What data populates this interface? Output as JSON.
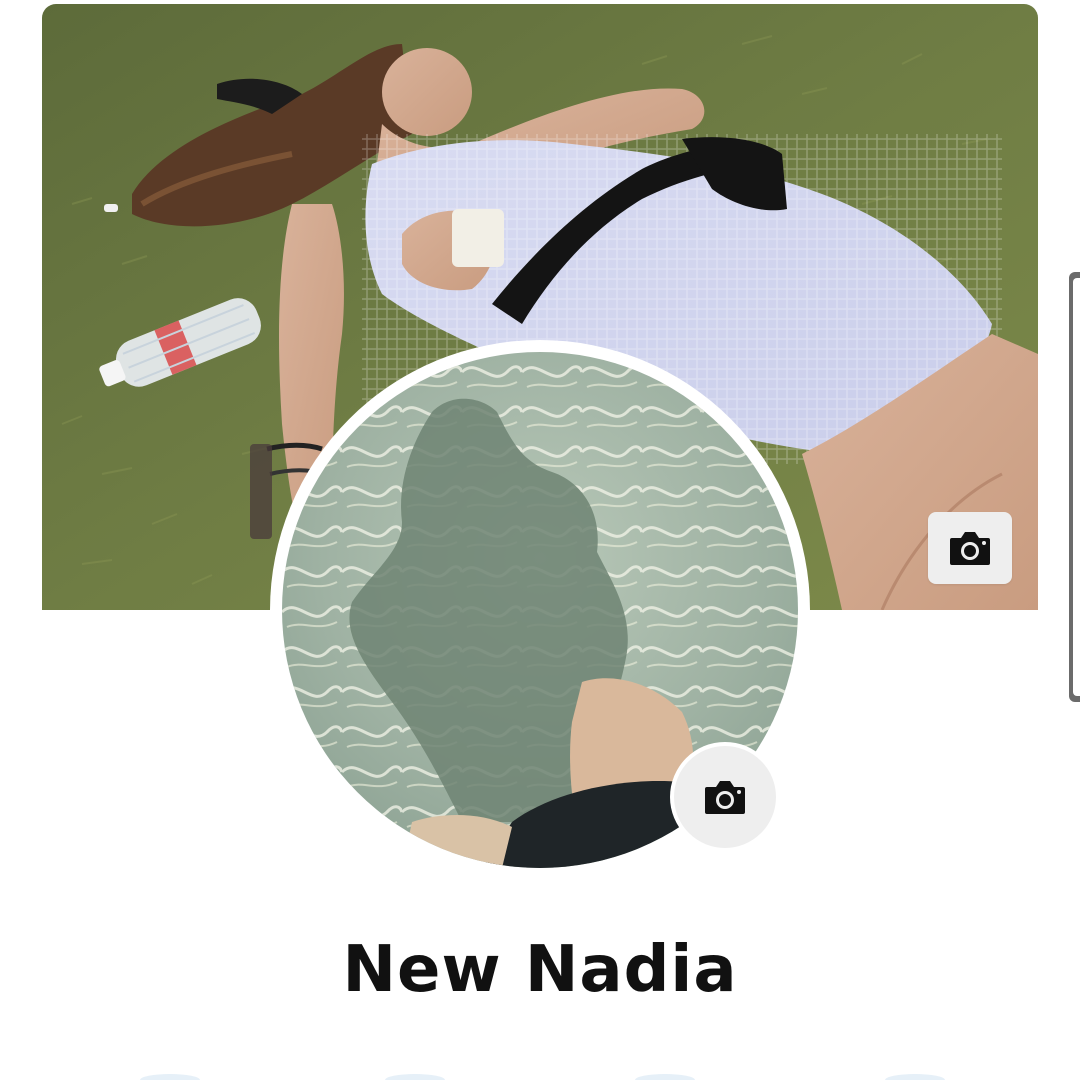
{
  "profile": {
    "name": "New Nadia"
  },
  "cover_photo": {
    "alt": "cover-photo",
    "edit_icon": "camera-icon"
  },
  "profile_picture": {
    "alt": "profile-picture",
    "edit_icon": "camera-icon"
  },
  "colors": {
    "background": "#ffffff",
    "button_bg": "#eeeeee",
    "name_text": "#111111",
    "icon": "#111111"
  }
}
